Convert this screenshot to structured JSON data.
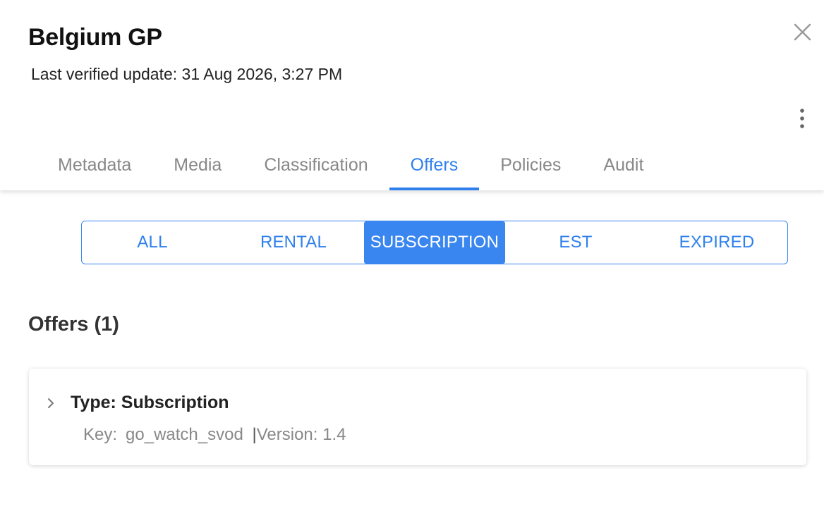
{
  "header": {
    "title": "Belgium GP",
    "last_update": "Last verified update: 31 Aug 2026, 3:27 PM",
    "close_icon": "close-icon",
    "more_icon": "more-vertical-icon"
  },
  "tabs": [
    {
      "label": "Metadata",
      "active": false
    },
    {
      "label": "Media",
      "active": false
    },
    {
      "label": "Classification",
      "active": false
    },
    {
      "label": "Offers",
      "active": true
    },
    {
      "label": "Policies",
      "active": false
    },
    {
      "label": "Audit",
      "active": false
    }
  ],
  "filters": [
    {
      "label": "ALL",
      "active": false
    },
    {
      "label": "RENTAL",
      "active": false
    },
    {
      "label": "SUBSCRIPTION",
      "active": true
    },
    {
      "label": "EST",
      "active": false
    },
    {
      "label": "EXPIRED",
      "active": false
    }
  ],
  "offers": {
    "heading": "Offers (1)",
    "items": [
      {
        "type": "Type: Subscription",
        "key_label": "Key:",
        "key_value": "go_watch_svod",
        "separator": "|",
        "version": "Version: 1.4"
      }
    ]
  },
  "colors": {
    "accent": "#2f80ed",
    "active_segment": "#3a86f0",
    "muted_text": "#888888"
  }
}
